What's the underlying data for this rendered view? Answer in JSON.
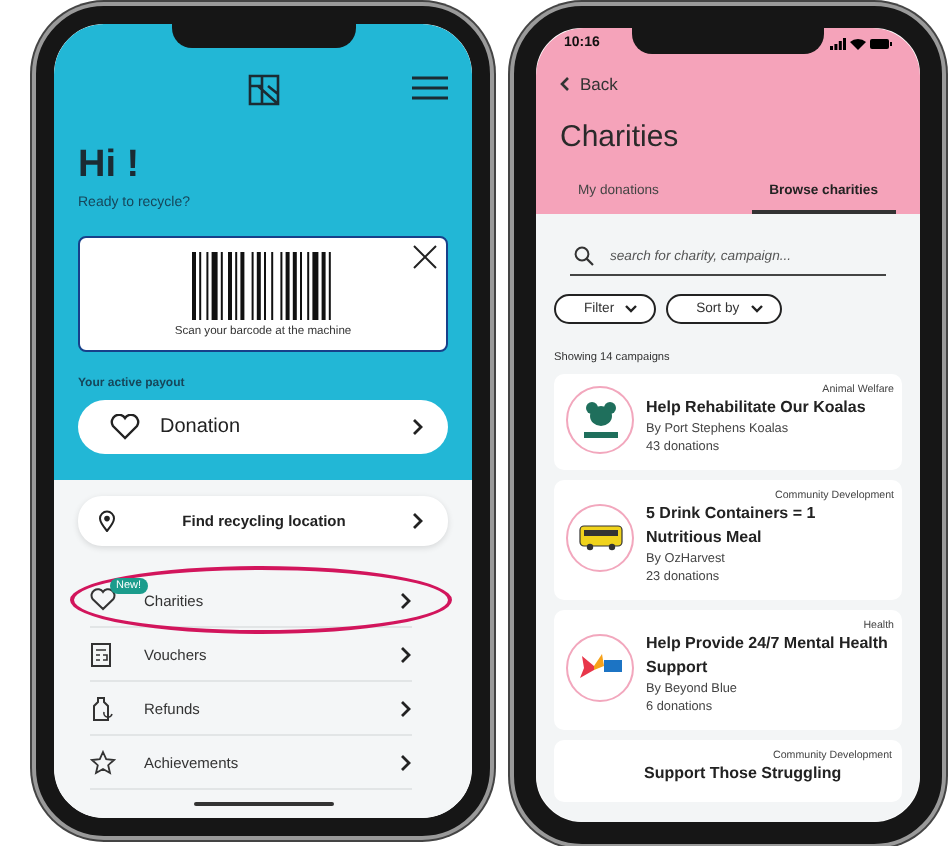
{
  "home_phone": {
    "greeting": "Hi !",
    "subtitle": "Ready to recycle?",
    "barcode_caption": "Scan your barcode at the machine",
    "payout_label": "Your active payout",
    "payout": "Donation",
    "location_button": "Find recycling location",
    "menu": [
      {
        "label": "Charities",
        "kind": "heart",
        "badge": "New!",
        "highlighted": true
      },
      {
        "label": "Vouchers",
        "kind": "voucher",
        "highlighted": false
      },
      {
        "label": "Refunds",
        "kind": "refund",
        "highlighted": false
      },
      {
        "label": "Achievements",
        "kind": "star",
        "highlighted": false
      }
    ]
  },
  "charities_phone": {
    "time": "10:16",
    "back": "Back",
    "title": "Charities",
    "tabs": [
      {
        "label": "My donations",
        "selected": false
      },
      {
        "label": "Browse charities",
        "selected": true
      }
    ],
    "search": {
      "placeholder": "search for charity, campaign..."
    },
    "filters": [
      "Filter",
      "Sort by"
    ],
    "count": "Showing 14 campaigns",
    "campaigns": [
      {
        "category": "Animal Welfare",
        "title": "Help Rehabilitate Our Koalas",
        "by": "By Port Stephens Koalas",
        "donations": "43 donations",
        "kind": "koala"
      },
      {
        "category": "Community Development",
        "title": "5 Drink Containers = 1 Nutritious Meal",
        "by": "By OzHarvest",
        "donations": "23 donations",
        "kind": "bus"
      },
      {
        "category": "Health",
        "title": "Help Provide 24/7 Mental Health Support",
        "by": "By Beyond Blue",
        "donations": "6 donations",
        "kind": "butterfly"
      },
      {
        "category": "Community Development",
        "title": "Support Those Struggling"
      }
    ]
  }
}
